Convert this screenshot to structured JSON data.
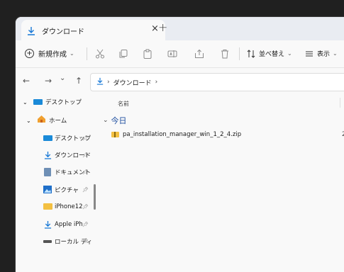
{
  "colors": {
    "accent": "#0067c0",
    "download": "#1677d6",
    "folder": "#f3c042"
  },
  "tab": {
    "title": "ダウンロード",
    "close": "×",
    "new_tab": "+"
  },
  "toolbar": {
    "new_label": "新規作成",
    "sort_label": "並べ替え",
    "view_label": "表示"
  },
  "nav": {
    "back": "←",
    "forward": "→",
    "recent": "⌄",
    "up": "↑",
    "breadcrumb": [
      "ダウンロード"
    ]
  },
  "sidebar": {
    "items": [
      {
        "label": "デスクトップ",
        "icon": "desktop-icon"
      },
      {
        "label": "ホーム",
        "icon": "home-icon"
      },
      {
        "label": "デスクトップ",
        "icon": "desktop-icon"
      },
      {
        "label": "ダウンロード",
        "icon": "download-icon"
      },
      {
        "label": "ドキュメント",
        "icon": "document-icon"
      },
      {
        "label": "ピクチャ",
        "icon": "picture-icon"
      },
      {
        "label": "iPhone12",
        "icon": "folder-icon"
      },
      {
        "label": "Apple iPh",
        "icon": "download-icon"
      },
      {
        "label": "ローカル ディ",
        "icon": "drive-icon"
      }
    ]
  },
  "main": {
    "column_name": "名前",
    "group_label": "今日",
    "files": [
      {
        "name": "pa_installation_manager_win_1_2_4.zip",
        "icon": "zip-folder-icon",
        "trailing": "2"
      }
    ]
  }
}
